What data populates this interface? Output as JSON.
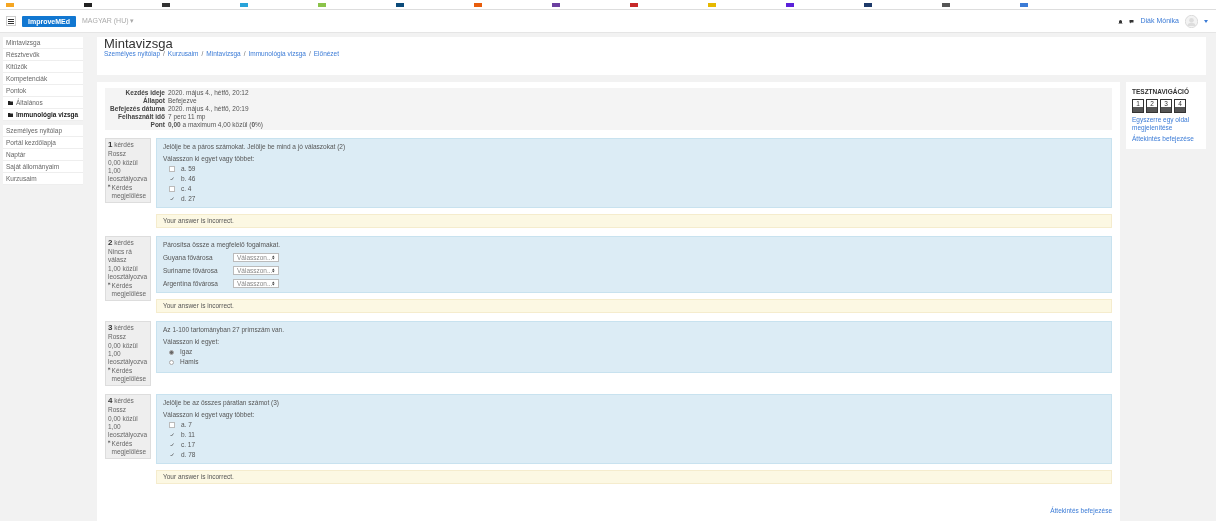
{
  "navbar": {
    "brand": "ImproveMEd",
    "language": "MAGYAR (HU) ▾",
    "user": "Diák Mónika"
  },
  "sidebar": {
    "groups": [
      [
        {
          "label": "Mintavizsga",
          "folder": false,
          "selected": false
        },
        {
          "label": "Résztvevők",
          "folder": false,
          "selected": false
        },
        {
          "label": "Kitűzők",
          "folder": false,
          "selected": false
        },
        {
          "label": "Kompetenciák",
          "folder": false,
          "selected": false
        },
        {
          "label": "Pontok",
          "folder": false,
          "selected": false
        },
        {
          "label": "Általános",
          "folder": true,
          "selected": false
        },
        {
          "label": "Immunológia vizsga",
          "folder": true,
          "selected": true
        }
      ],
      [
        {
          "label": "Személyes nyitólap",
          "folder": false,
          "selected": false
        },
        {
          "label": "Portál kezdőlapja",
          "folder": false,
          "selected": false
        },
        {
          "label": "Naptár",
          "folder": false,
          "selected": false
        },
        {
          "label": "Saját állományaim",
          "folder": false,
          "selected": false
        },
        {
          "label": "Kurzusaim",
          "folder": false,
          "selected": false
        }
      ]
    ]
  },
  "header": {
    "title": "Mintavizsga",
    "separator": "/",
    "breadcrumb": [
      "Személyes nyitólap",
      "Kurzusaim",
      "Mintavizsga",
      "Immunológia vizsga",
      "Előnézet"
    ]
  },
  "summary": [
    {
      "label": "Kezdés ideje",
      "value": "2020. május 4., hétfő, 20:12"
    },
    {
      "label": "Állapot",
      "value": "Befejezve"
    },
    {
      "label": "Befejezés dátuma",
      "value": "2020. május 4., hétfő, 20:19"
    },
    {
      "label": "Felhasznált idő",
      "value": "7 perc 11 mp"
    },
    {
      "label": "Pont",
      "value": "**0,00** a maximum 4,00 közül (**0**%)"
    }
  ],
  "questions": [
    {
      "number": "1",
      "label": "kérdés",
      "status": "Rossz",
      "grade": "0,00 közül 1,00 leosztályozva",
      "flag": "Kérdés megjelölése",
      "kind": "multi",
      "text": "Jelölje be a páros számokat. Jelölje be mind a jó válaszokat (2)",
      "prompt": "Válasszon ki egyet vagy többet:",
      "options": [
        {
          "label": "a. 59",
          "checked": false
        },
        {
          "label": "b. 46",
          "checked": true
        },
        {
          "label": "c. 4",
          "checked": false
        },
        {
          "label": "d. 27",
          "checked": true
        }
      ],
      "feedback": "Your answer is incorrect."
    },
    {
      "number": "2",
      "label": "kérdés",
      "status": "Nincs rá válasz",
      "grade": "1,00 közül leosztályozva",
      "flag": "Kérdés megjelölése",
      "kind": "match",
      "text": "Párosítsa össze a megfelelő fogalmakat.",
      "pairs": [
        {
          "label": "Guyana fővárosa",
          "value": "Válasszon..."
        },
        {
          "label": "Suriname fővárosa",
          "value": "Válasszon..."
        },
        {
          "label": "Argentína fővárosa",
          "value": "Válasszon..."
        }
      ],
      "feedback": "Your answer is incorrect."
    },
    {
      "number": "3",
      "label": "kérdés",
      "status": "Rossz",
      "grade": "0,00 közül 1,00 leosztályozva",
      "flag": "Kérdés megjelölése",
      "kind": "single",
      "text": "Az 1-100 tartományban 27 prímszám van.",
      "prompt": "Válasszon ki egyet:",
      "options": [
        {
          "label": "Igaz",
          "selected": true
        },
        {
          "label": "Hamis",
          "selected": false
        }
      ]
    },
    {
      "number": "4",
      "label": "kérdés",
      "status": "Rossz",
      "grade": "0,00 közül 1,00 leosztályozva",
      "flag": "Kérdés megjelölése",
      "kind": "multi",
      "text": "Jelölje be az összes páratlan számot (3)",
      "prompt": "Válasszon ki egyet vagy többet:",
      "options": [
        {
          "label": "a. 7",
          "checked": false
        },
        {
          "label": "b. 11",
          "checked": true
        },
        {
          "label": "c. 17",
          "checked": true
        },
        {
          "label": "d. 78",
          "checked": true
        }
      ],
      "feedback": "Your answer is incorrect."
    }
  ],
  "finish_link": "Áttekintés befejezése",
  "quiz_nav": {
    "title": "TESZTNAVIGÁCIÓ",
    "buttons": [
      "1",
      "2",
      "3",
      "4"
    ],
    "links": [
      "Egyszerre egy oldal megjelenítése",
      "Áttekintés befejezése"
    ]
  }
}
